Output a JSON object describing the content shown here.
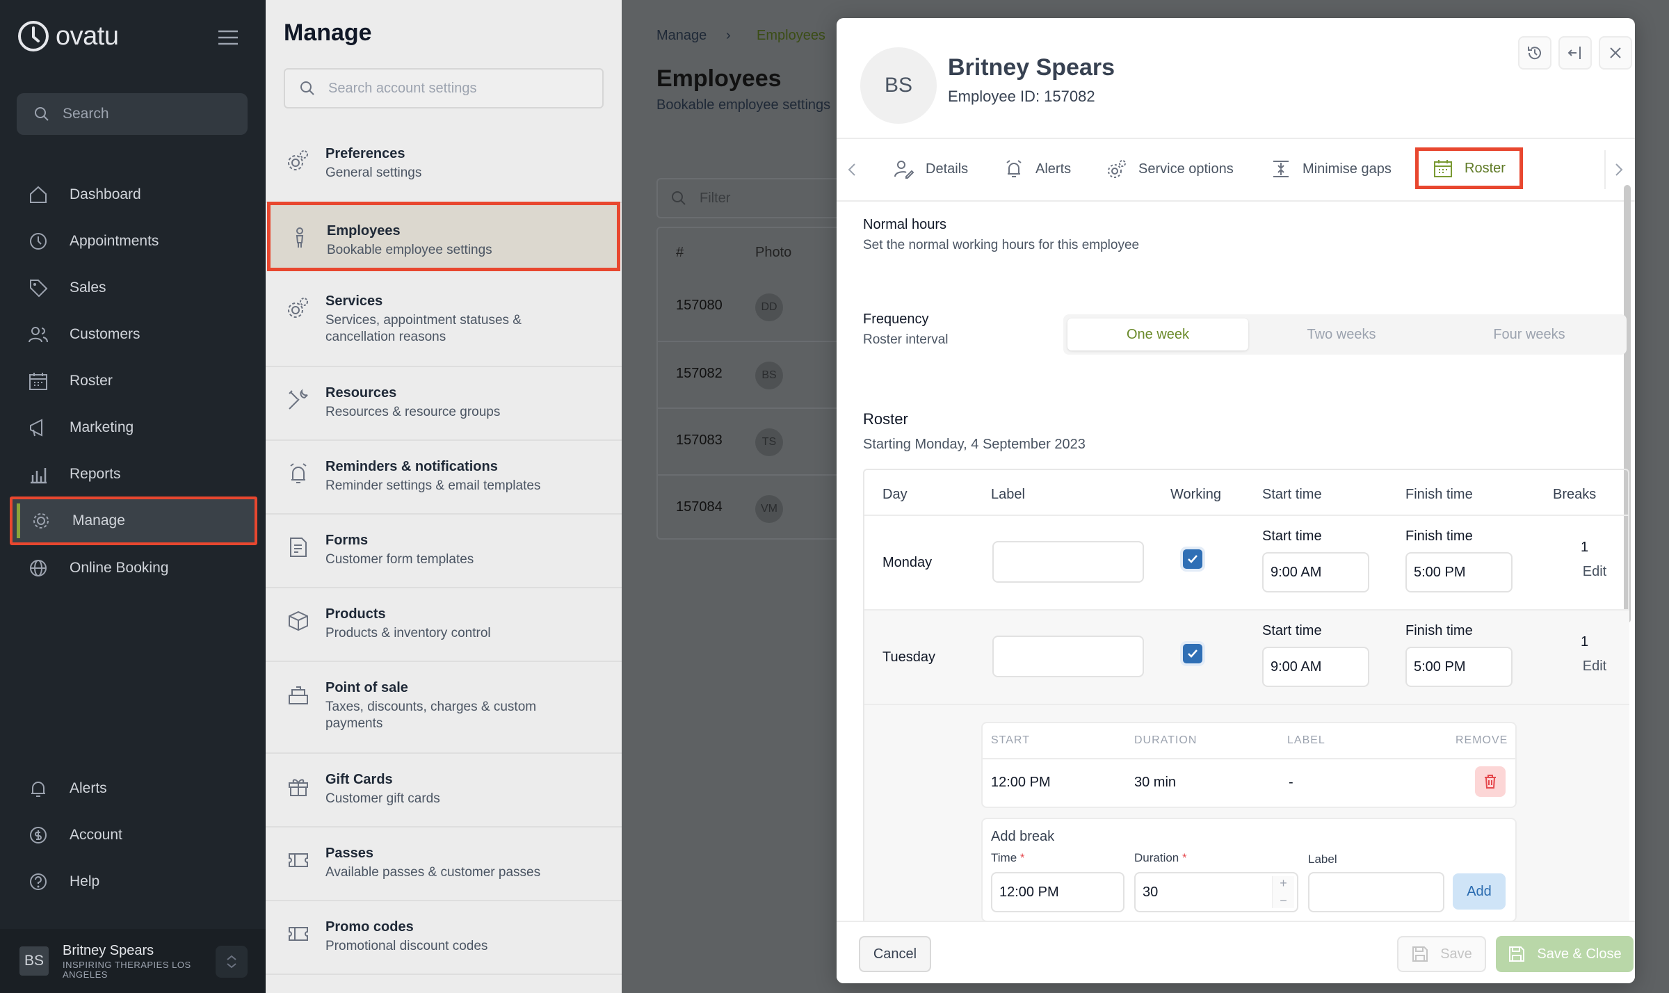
{
  "brand": {
    "name": "ovatu"
  },
  "sidebar": {
    "search_label": "Search",
    "items": [
      {
        "label": "Dashboard",
        "icon": "home-icon"
      },
      {
        "label": "Appointments",
        "icon": "clock-icon"
      },
      {
        "label": "Sales",
        "icon": "tag-icon"
      },
      {
        "label": "Customers",
        "icon": "users-icon"
      },
      {
        "label": "Roster",
        "icon": "calendar-icon"
      },
      {
        "label": "Marketing",
        "icon": "megaphone-icon"
      },
      {
        "label": "Reports",
        "icon": "chart-icon"
      },
      {
        "label": "Manage",
        "icon": "gear-icon"
      },
      {
        "label": "Online Booking",
        "icon": "globe-icon"
      }
    ],
    "bottom_items": [
      {
        "label": "Alerts",
        "icon": "bell-icon"
      },
      {
        "label": "Account",
        "icon": "account-icon"
      },
      {
        "label": "Help",
        "icon": "help-icon"
      }
    ],
    "user": {
      "initials": "BS",
      "name": "Britney Spears",
      "org": "INSPIRING THERAPIES LOS ANGELES"
    }
  },
  "manage": {
    "title": "Manage",
    "search_placeholder": "Search account settings",
    "items": [
      {
        "title": "Preferences",
        "subtitle": "General settings"
      },
      {
        "title": "Employees",
        "subtitle": "Bookable employee settings"
      },
      {
        "title": "Services",
        "subtitle": "Services, appointment statuses & cancellation reasons"
      },
      {
        "title": "Resources",
        "subtitle": "Resources & resource groups"
      },
      {
        "title": "Reminders & notifications",
        "subtitle": "Reminder settings & email templates"
      },
      {
        "title": "Forms",
        "subtitle": "Customer form templates"
      },
      {
        "title": "Products",
        "subtitle": "Products & inventory control"
      },
      {
        "title": "Point of sale",
        "subtitle": "Taxes, discounts, charges & custom payments"
      },
      {
        "title": "Gift Cards",
        "subtitle": "Customer gift cards"
      },
      {
        "title": "Passes",
        "subtitle": "Available passes & customer passes"
      },
      {
        "title": "Promo codes",
        "subtitle": "Promotional discount codes"
      }
    ]
  },
  "employees_page": {
    "breadcrumb": [
      "Manage",
      "Employees"
    ],
    "title": "Employees",
    "subtitle": "Bookable employee settings",
    "filter_placeholder": "Filter",
    "columns": [
      "#",
      "Photo"
    ],
    "rows": [
      {
        "id": "157080",
        "initials": "DD"
      },
      {
        "id": "157082",
        "initials": "BS"
      },
      {
        "id": "157083",
        "initials": "TS"
      },
      {
        "id": "157084",
        "initials": "VM"
      }
    ]
  },
  "drawer": {
    "initials": "BS",
    "name": "Britney Spears",
    "employee_id": "Employee ID: 157082",
    "tabs": [
      "Details",
      "Alerts",
      "Service options",
      "Minimise gaps",
      "Roster"
    ],
    "active_tab": "Roster",
    "normal_hours": {
      "title": "Normal hours",
      "subtitle": "Set the normal working hours for this employee"
    },
    "frequency": {
      "title": "Frequency",
      "subtitle": "Roster interval",
      "options": [
        "One week",
        "Two weeks",
        "Four weeks"
      ],
      "selected": "One week"
    },
    "roster": {
      "title": "Roster",
      "starting": "Starting Monday, 4 September 2023",
      "columns": [
        "Day",
        "Label",
        "Working",
        "Start time",
        "Finish time",
        "Breaks"
      ],
      "rows": [
        {
          "day": "Monday",
          "working": true,
          "start_label": "Start time",
          "start": "9:00 AM",
          "finish_label": "Finish time",
          "finish": "5:00 PM",
          "breaks": "1",
          "edit": "Edit"
        },
        {
          "day": "Tuesday",
          "working": true,
          "start_label": "Start time",
          "start": "9:00 AM",
          "finish_label": "Finish time",
          "finish": "5:00 PM",
          "breaks": "1",
          "edit": "Edit"
        }
      ],
      "breaks_table": {
        "columns": [
          "START",
          "DURATION",
          "LABEL",
          "REMOVE"
        ],
        "rows": [
          {
            "start": "12:00 PM",
            "duration": "30 min",
            "label": "-"
          }
        ]
      },
      "add_break": {
        "title": "Add break",
        "time_label": "Time",
        "time_value": "12:00 PM",
        "duration_label": "Duration",
        "duration_value": "30",
        "label_label": "Label",
        "label_value": "",
        "add_button": "Add",
        "required_mark": "*"
      }
    },
    "footer": {
      "cancel": "Cancel",
      "save": "Save",
      "save_close": "Save & Close"
    }
  },
  "colors": {
    "accent_green": "#6a8a2a",
    "highlight_red": "#e8472f",
    "sidebar_bg": "#1f252b",
    "checkbox_blue": "#2f6fb5"
  }
}
